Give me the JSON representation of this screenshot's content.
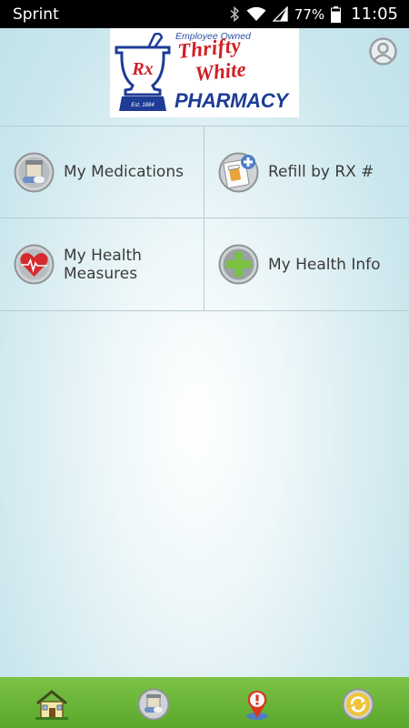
{
  "status_bar": {
    "carrier": "Sprint",
    "battery_percent": "77%",
    "time": "11:05",
    "icons": [
      "bluetooth-icon",
      "wifi-icon",
      "signal-icon",
      "battery-icon"
    ]
  },
  "header": {
    "logo": {
      "tagline": "Employee Owned",
      "line1": "Thrifty",
      "line2": "White",
      "line3": "PHARMACY",
      "est": "Est. 1884",
      "rx": "Rx"
    },
    "profile_icon": "user-profile-icon"
  },
  "menu": {
    "items": [
      {
        "label": "My Medications",
        "icon": "medications-icon"
      },
      {
        "label": "Refill by RX #",
        "icon": "refill-icon"
      },
      {
        "label": "My Health Measures",
        "icon": "heart-rate-icon"
      },
      {
        "label": "My Health Info",
        "icon": "health-plus-icon"
      }
    ]
  },
  "bottom_nav": {
    "items": [
      {
        "name": "home",
        "icon": "home-icon"
      },
      {
        "name": "medications",
        "icon": "medications-icon"
      },
      {
        "name": "pharmacy-location",
        "icon": "location-alert-icon"
      },
      {
        "name": "refresh",
        "icon": "refresh-icon"
      }
    ]
  },
  "colors": {
    "status_bar_bg": "#000000",
    "nav_green": "#6ab63a",
    "logo_red": "#d11f26",
    "logo_blue": "#1e3c96",
    "divider": "#b6ccd2",
    "text": "#3a3a3a"
  }
}
